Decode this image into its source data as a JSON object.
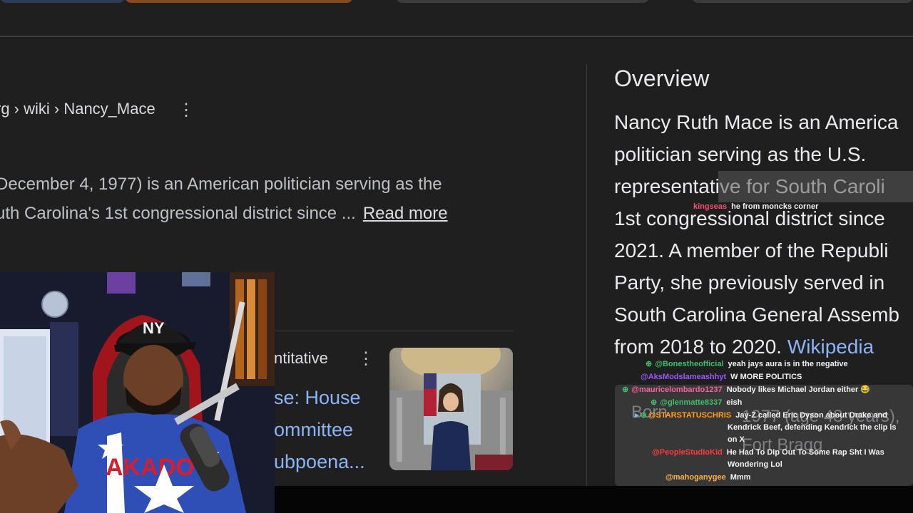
{
  "search": {
    "breadcrumb": "rg › wiki › Nancy_Mace",
    "snippet_line1": "December 4, 1977) is an American politician serving as the",
    "snippet_line2": "uth Carolina's 1st congressional district since ...",
    "read_more": "Read more",
    "result2_label": "ntitative",
    "result2_title_lines": [
      "se: House",
      "ommittee",
      "ubpoena..."
    ]
  },
  "overview": {
    "title": "Overview",
    "lines": [
      "Nancy Ruth Mace is an America",
      "politician serving as the U.S.",
      "representative for South Caroli",
      "1st congressional district since",
      "2021. A member of the Republi",
      "Party, she previously served in",
      "South Carolina General Assemb"
    ],
    "last_line": "from 2018 to 2020.",
    "wiki_link": "Wikipedia",
    "born_label": "Born",
    "born_value_1": "1977 (age 48 years),",
    "born_value_2": "Fort Bragg"
  },
  "chat": {
    "messages": [
      {
        "user": "kingseas",
        "text": "he from moncks corner",
        "color": "#ff4d6d"
      },
      {
        "user": "@Bonestheofficial",
        "text": "yeah jays aura is in the negative",
        "color": "#3fbf6f"
      },
      {
        "user": "@AksModslameashhyt",
        "text": "W MORE POLITICS",
        "color": "#9b59ff"
      },
      {
        "user": "@mauricelombardo1237",
        "text": "Nobody likes Michael Jordan either 😂",
        "color": "#ff5fa2"
      },
      {
        "user": "@glenmatte8337",
        "text": "eish",
        "color": "#3fbf6f"
      },
      {
        "user": "@STARSTATUSCHRIS",
        "text": "Jay-Z called Eric Dyson about Drake and",
        "color": "#ff9f1a"
      },
      {
        "user": "@PeopleStudioKid",
        "text": "He Had To Dip Out To Some Rap Sht I Was",
        "color": "#ff3b3b"
      },
      {
        "user": "@mahoganygee",
        "text": "Mmm",
        "color": "#ffb347"
      }
    ],
    "wraps": {
      "starstatus_2": "Kendrick Beef, defending Kendrick the clip is",
      "starstatus_3": "on X",
      "peoplestudio_2": "Wondering Lol"
    }
  },
  "webcam": {
    "cap_logo": "NY",
    "jersey_text": "AKADO"
  },
  "colors": {
    "background": "#1f1f1f",
    "link": "#8ab4f8",
    "text": "#e8eaed"
  }
}
